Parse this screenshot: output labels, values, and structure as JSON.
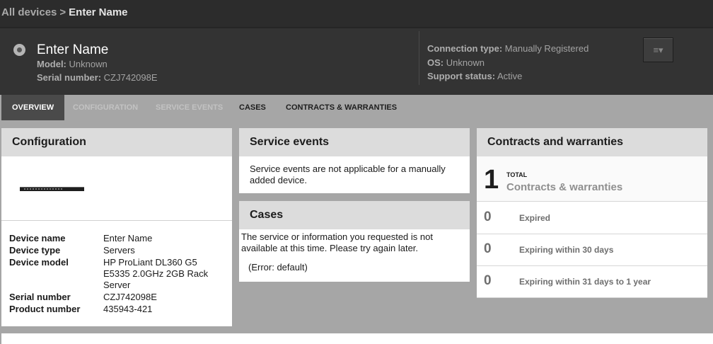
{
  "breadcrumb": {
    "root": "All devices",
    "separator": ">",
    "current": "Enter Name"
  },
  "header": {
    "device_icon": "device-status-dot-icon",
    "title": "Enter Name",
    "model_label": "Model:",
    "model_value": "Unknown",
    "serial_label": "Serial number:",
    "serial_value": "CZJ742098E",
    "connection_label": "Connection type:",
    "connection_value": "Manually Registered",
    "os_label": "OS:",
    "os_value": "Unknown",
    "support_label": "Support status:",
    "support_value": "Active",
    "menu_button_icon": "≡▾"
  },
  "tabs": [
    {
      "label": "Overview",
      "state": "active"
    },
    {
      "label": "Configuration",
      "state": "disabled"
    },
    {
      "label": "Service events",
      "state": "disabled"
    },
    {
      "label": "Cases",
      "state": "enabled"
    },
    {
      "label": "Contracts & warranties",
      "state": "enabled"
    }
  ],
  "configuration": {
    "title": "Configuration",
    "image": "server-rack-image",
    "rows": [
      {
        "label": "Device name",
        "value": "Enter Name"
      },
      {
        "label": "Device type",
        "value": "Servers"
      },
      {
        "label": "Device model",
        "value": "HP ProLiant DL360 G5 E5335 2.0GHz 2GB Rack Server"
      },
      {
        "label": "Serial number",
        "value": "CZJ742098E"
      },
      {
        "label": "Product number",
        "value": "435943-421"
      }
    ]
  },
  "service_events": {
    "title": "Service events",
    "message": "Service events are not applicable for a manually added device."
  },
  "cases": {
    "title": "Cases",
    "message": "The service or information you requested is not available at this time. Please try again later.",
    "error": "(Error: default)"
  },
  "contracts": {
    "title": "Contracts and warranties",
    "total": {
      "count": "1",
      "small_label": "TOTAL",
      "label": "Contracts & warranties"
    },
    "rows": [
      {
        "count": "0",
        "label": "Expired"
      },
      {
        "count": "0",
        "label": "Expiring within 30 days"
      },
      {
        "count": "0",
        "label": "Expiring within 31 days to 1 year"
      }
    ]
  },
  "colors": {
    "header_bg": "#333333",
    "tab_active_bg": "#4a4a4a",
    "page_bg": "#a6a6a6",
    "panel_head_bg": "#dcdcdc"
  }
}
